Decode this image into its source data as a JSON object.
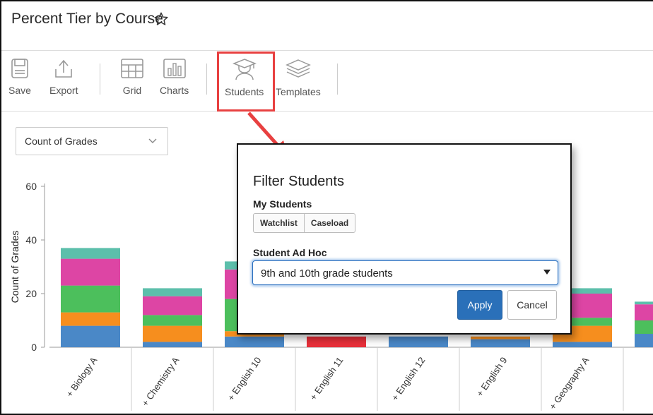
{
  "header": {
    "title": "Percent Tier by Course"
  },
  "toolbar": {
    "save": "Save",
    "export": "Export",
    "grid": "Grid",
    "charts": "Charts",
    "students": "Students",
    "templates": "Templates"
  },
  "measure_select": {
    "value": "Count of Grades"
  },
  "modal": {
    "title": "Filter Students",
    "my_students_label": "My Students",
    "watchlist": "Watchlist",
    "caseload": "Caseload",
    "adhoc_label": "Student Ad Hoc",
    "adhoc_value": "9th and 10th grade students",
    "apply": "Apply",
    "cancel": "Cancel"
  },
  "colors": {
    "blue": "#4a88c7",
    "orange": "#f68e1e",
    "green": "#4cbf5c",
    "magenta": "#dd45a4",
    "teal": "#5cbfab",
    "red": "#e8303a",
    "highlight": "#e84040",
    "apply": "#2a70b9"
  },
  "chart_data": {
    "type": "bar",
    "stacked": true,
    "ylabel": "Count of Grades",
    "ylim": [
      0,
      60
    ],
    "yticks": [
      0,
      20,
      40,
      60
    ],
    "categories": [
      "+ Biology A",
      "+ Chemistry A",
      "+ English 10",
      "+ English 11",
      "+ English 12",
      "+ English 9",
      "+ Geography A",
      "+ ..."
    ],
    "series": [
      {
        "color": "#4a88c7",
        "values": [
          8,
          2,
          4,
          0,
          4,
          3,
          2,
          5
        ]
      },
      {
        "color": "#f68e1e",
        "values": [
          5,
          6,
          2,
          0,
          0,
          1,
          6,
          0
        ]
      },
      {
        "color": "#4cbf5c",
        "values": [
          10,
          4,
          12,
          0,
          0,
          0,
          3,
          5
        ]
      },
      {
        "color": "#dd45a4",
        "values": [
          10,
          7,
          11,
          0,
          0,
          0,
          9,
          6
        ]
      },
      {
        "color": "#5cbfab",
        "values": [
          4,
          3,
          3,
          0,
          0,
          0,
          2,
          1
        ]
      },
      {
        "color": "#e8303a",
        "values": [
          0,
          0,
          0,
          4,
          0,
          0,
          0,
          0
        ]
      }
    ]
  }
}
